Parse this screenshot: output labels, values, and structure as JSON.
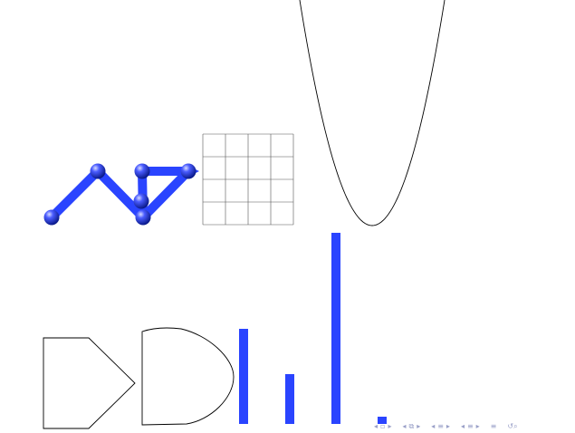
{
  "colors": {
    "accent": "#2a44ff",
    "stroke": "#000000",
    "grid": "#555555",
    "nav": "#9aa0c8"
  },
  "grid": {
    "rows": 4,
    "cols": 4
  },
  "bars": {
    "values": [
      105,
      55,
      211,
      8
    ]
  },
  "nav": {
    "icons": [
      "nav-prev-frame-icon",
      "nav-frame-icon",
      "nav-next-frame-icon",
      "nav-prev-subsection-icon",
      "nav-subsection-icon",
      "nav-next-subsection-icon",
      "nav-prev-section-icon",
      "nav-section-icon",
      "nav-next-section-icon",
      "nav-prev-doc-icon",
      "nav-doc-icon",
      "nav-next-doc-icon",
      "nav-align-icon",
      "nav-search-icon"
    ]
  }
}
